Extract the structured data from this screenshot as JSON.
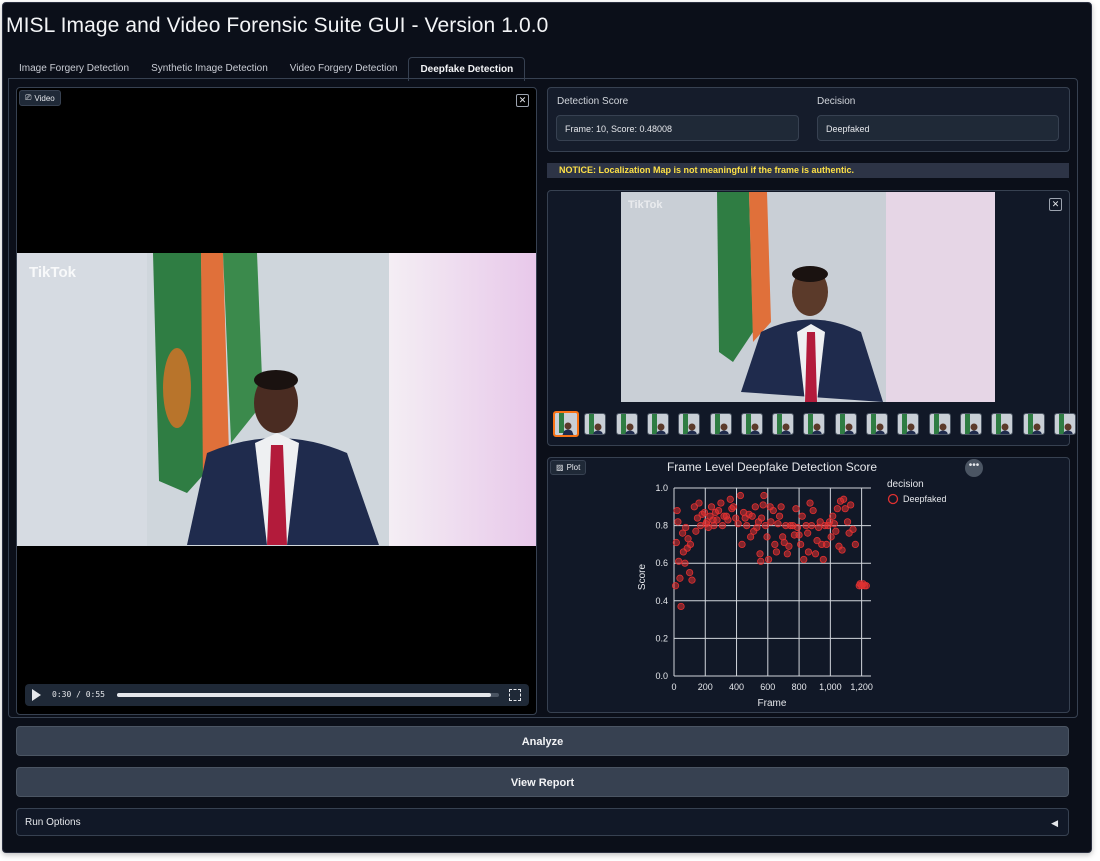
{
  "app": {
    "title": "MISL Image and Video Forensic Suite GUI - Version 1.0.0"
  },
  "tabs": [
    {
      "label": "Image Forgery Detection",
      "active": false
    },
    {
      "label": "Synthetic Image Detection",
      "active": false
    },
    {
      "label": "Video Forgery Detection",
      "active": false
    },
    {
      "label": "Deepfake Detection",
      "active": true
    }
  ],
  "video_panel": {
    "label": "Video",
    "watermark": "TikTok",
    "time": "0:30 / 0:55",
    "progress": 0.98
  },
  "results": {
    "score_label": "Detection Score",
    "score_value": "Frame: 10, Score: 0.48008",
    "decision_label": "Decision",
    "decision_value": "Deepfaked"
  },
  "notice": "NOTICE: Localization Map is not meaningful if the frame is authentic.",
  "gallery": {
    "thumbnail_count": 17,
    "selected_index": 0,
    "watermark": "TikTok"
  },
  "plot_panel": {
    "label": "Plot"
  },
  "chart_data": {
    "type": "scatter",
    "title": "Frame Level Deepfake Detection Score",
    "xlabel": "Frame",
    "ylabel": "Score",
    "xlim": [
      0,
      1260
    ],
    "ylim": [
      0,
      1.0
    ],
    "x_ticks": [
      "0",
      "200",
      "400",
      "600",
      "800",
      "1,000",
      "1,200"
    ],
    "y_ticks": [
      "0.0",
      "0.2",
      "0.4",
      "0.6",
      "0.8",
      "1.0"
    ],
    "grid": true,
    "legend": {
      "title": "decision",
      "position": "right"
    },
    "series": [
      {
        "name": "Deepfaked",
        "color": "#e03131",
        "points": [
          [
            10,
            0.48
          ],
          [
            15,
            0.71
          ],
          [
            20,
            0.88
          ],
          [
            25,
            0.82
          ],
          [
            30,
            0.61
          ],
          [
            38,
            0.52
          ],
          [
            45,
            0.37
          ],
          [
            55,
            0.76
          ],
          [
            60,
            0.66
          ],
          [
            70,
            0.6
          ],
          [
            75,
            0.79
          ],
          [
            85,
            0.68
          ],
          [
            90,
            0.73
          ],
          [
            100,
            0.55
          ],
          [
            105,
            0.7
          ],
          [
            115,
            0.51
          ],
          [
            130,
            0.9
          ],
          [
            140,
            0.77
          ],
          [
            150,
            0.84
          ],
          [
            160,
            0.92
          ],
          [
            170,
            0.8
          ],
          [
            180,
            0.86
          ],
          [
            195,
            0.87
          ],
          [
            205,
            0.81
          ],
          [
            210,
            0.82
          ],
          [
            220,
            0.79
          ],
          [
            230,
            0.85
          ],
          [
            240,
            0.9
          ],
          [
            250,
            0.83
          ],
          [
            255,
            0.8
          ],
          [
            265,
            0.87
          ],
          [
            275,
            0.83
          ],
          [
            285,
            0.88
          ],
          [
            300,
            0.92
          ],
          [
            310,
            0.8
          ],
          [
            320,
            0.85
          ],
          [
            335,
            0.85
          ],
          [
            345,
            0.83
          ],
          [
            360,
            0.94
          ],
          [
            370,
            0.89
          ],
          [
            380,
            0.9
          ],
          [
            395,
            0.84
          ],
          [
            410,
            0.81
          ],
          [
            425,
            0.96
          ],
          [
            435,
            0.7
          ],
          [
            445,
            0.87
          ],
          [
            455,
            0.84
          ],
          [
            465,
            0.8
          ],
          [
            480,
            0.86
          ],
          [
            490,
            0.74
          ],
          [
            500,
            0.85
          ],
          [
            510,
            0.77
          ],
          [
            520,
            0.9
          ],
          [
            530,
            0.79
          ],
          [
            540,
            0.82
          ],
          [
            550,
            0.65
          ],
          [
            555,
            0.61
          ],
          [
            560,
            0.84
          ],
          [
            570,
            0.91
          ],
          [
            575,
            0.96
          ],
          [
            585,
            0.8
          ],
          [
            595,
            0.74
          ],
          [
            605,
            0.62
          ],
          [
            615,
            0.9
          ],
          [
            620,
            0.82
          ],
          [
            635,
            0.88
          ],
          [
            645,
            0.7
          ],
          [
            655,
            0.66
          ],
          [
            665,
            0.81
          ],
          [
            675,
            0.85
          ],
          [
            685,
            0.9
          ],
          [
            695,
            0.74
          ],
          [
            705,
            0.71
          ],
          [
            715,
            0.8
          ],
          [
            725,
            0.65
          ],
          [
            735,
            0.69
          ],
          [
            745,
            0.8
          ],
          [
            760,
            0.8
          ],
          [
            770,
            0.75
          ],
          [
            780,
            0.89
          ],
          [
            790,
            0.79
          ],
          [
            800,
            0.75
          ],
          [
            810,
            0.7
          ],
          [
            820,
            0.85
          ],
          [
            830,
            0.62
          ],
          [
            845,
            0.8
          ],
          [
            855,
            0.76
          ],
          [
            860,
            0.66
          ],
          [
            870,
            0.92
          ],
          [
            880,
            0.8
          ],
          [
            890,
            0.88
          ],
          [
            905,
            0.65
          ],
          [
            915,
            0.72
          ],
          [
            925,
            0.79
          ],
          [
            935,
            0.82
          ],
          [
            945,
            0.7
          ],
          [
            955,
            0.62
          ],
          [
            965,
            0.8
          ],
          [
            975,
            0.7
          ],
          [
            985,
            0.8
          ],
          [
            995,
            0.82
          ],
          [
            1005,
            0.74
          ],
          [
            1015,
            0.85
          ],
          [
            1025,
            0.81
          ],
          [
            1035,
            0.77
          ],
          [
            1045,
            0.89
          ],
          [
            1055,
            0.69
          ],
          [
            1065,
            0.93
          ],
          [
            1075,
            0.67
          ],
          [
            1085,
            0.94
          ],
          [
            1095,
            0.89
          ],
          [
            1110,
            0.82
          ],
          [
            1120,
            0.76
          ],
          [
            1130,
            0.91
          ],
          [
            1145,
            0.78
          ],
          [
            1160,
            0.7
          ],
          [
            1185,
            0.48
          ],
          [
            1190,
            0.49
          ],
          [
            1200,
            0.48
          ],
          [
            1210,
            0.49
          ],
          [
            1220,
            0.48
          ],
          [
            1230,
            0.48
          ]
        ]
      }
    ]
  },
  "buttons": {
    "analyze": "Analyze",
    "view_report": "View Report"
  },
  "run_options": {
    "label": "Run Options",
    "arrow": "◀"
  }
}
